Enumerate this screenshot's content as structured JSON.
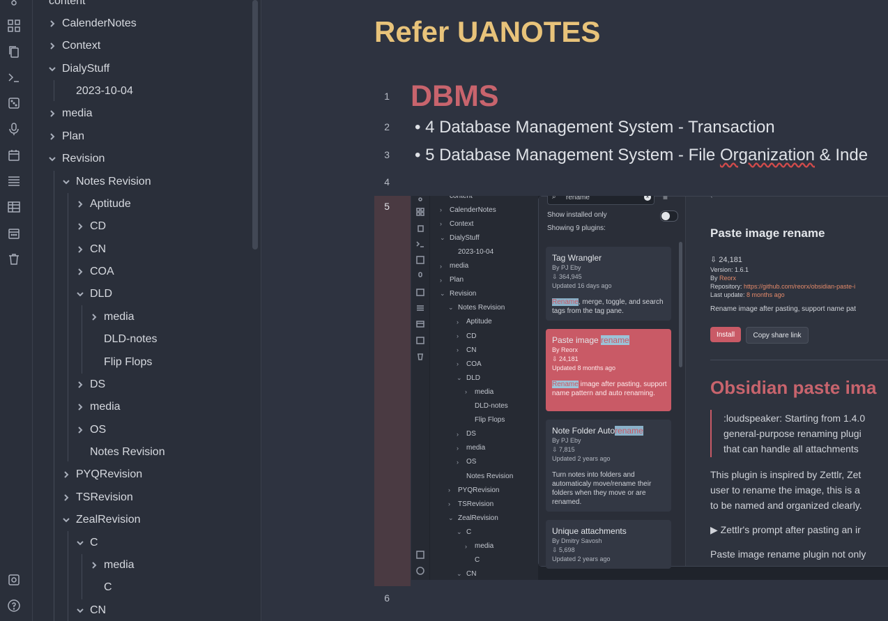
{
  "sidebar": {
    "items": [
      {
        "label": "content",
        "chev": "none",
        "depth": 0
      },
      {
        "label": "CalenderNotes",
        "chev": "right",
        "depth": 0
      },
      {
        "label": "Context",
        "chev": "right",
        "depth": 0
      },
      {
        "label": "DialyStuff",
        "chev": "down",
        "depth": 0
      },
      {
        "label": "2023-10-04",
        "chev": "none",
        "depth": 1
      },
      {
        "label": "media",
        "chev": "right",
        "depth": 0
      },
      {
        "label": "Plan",
        "chev": "right",
        "depth": 0
      },
      {
        "label": "Revision",
        "chev": "down",
        "depth": 0
      },
      {
        "label": "Notes Revision",
        "chev": "down",
        "depth": 1
      },
      {
        "label": "Aptitude",
        "chev": "right",
        "depth": 2
      },
      {
        "label": "CD",
        "chev": "right",
        "depth": 2
      },
      {
        "label": "CN",
        "chev": "right",
        "depth": 2
      },
      {
        "label": "COA",
        "chev": "right",
        "depth": 2
      },
      {
        "label": "DLD",
        "chev": "down",
        "depth": 2
      },
      {
        "label": "media",
        "chev": "right",
        "depth": 3
      },
      {
        "label": "DLD-notes",
        "chev": "none",
        "depth": 3
      },
      {
        "label": "Flip Flops",
        "chev": "none",
        "depth": 3
      },
      {
        "label": "DS",
        "chev": "right",
        "depth": 2
      },
      {
        "label": "media",
        "chev": "right",
        "depth": 2
      },
      {
        "label": "OS",
        "chev": "right",
        "depth": 2
      },
      {
        "label": "Notes Revision",
        "chev": "none",
        "depth": 2
      },
      {
        "label": "PYQRevision",
        "chev": "right",
        "depth": 1
      },
      {
        "label": "TSRevision",
        "chev": "right",
        "depth": 1
      },
      {
        "label": "ZealRevision",
        "chev": "down",
        "depth": 1
      },
      {
        "label": "C",
        "chev": "down",
        "depth": 2
      },
      {
        "label": "media",
        "chev": "right",
        "depth": 3
      },
      {
        "label": "C",
        "chev": "none",
        "depth": 3
      },
      {
        "label": "CN",
        "chev": "down",
        "depth": 2
      }
    ]
  },
  "ribbon": {
    "icons": [
      "git-icon",
      "dashboard-icon",
      "copy-icon",
      "terminal-icon",
      "dice-icon",
      "microphone-icon",
      "calendar-icon",
      "list-icon",
      "table-icon",
      "calendar-grid-icon",
      "trash-icon",
      "vault-icon",
      "help-icon"
    ]
  },
  "editor": {
    "title": "Refer UANOTES",
    "lines": [
      {
        "n": "1",
        "text": "DBMS"
      },
      {
        "n": "2",
        "text": "• 4 Database Management System - Transaction"
      },
      {
        "n": "3",
        "text_a": "• 5 Database Management System - File ",
        "text_b": "Organization",
        "text_c": " & Inde"
      },
      {
        "n": "4",
        "text": ""
      },
      {
        "n": "5",
        "text": ""
      },
      {
        "n": "6",
        "text": ""
      }
    ]
  },
  "embed": {
    "sidebar_items": [
      {
        "label": "content",
        "chev": "",
        "depth": 0
      },
      {
        "label": "CalenderNotes",
        "chev": ">",
        "depth": 0
      },
      {
        "label": "Context",
        "chev": ">",
        "depth": 0
      },
      {
        "label": "DialyStuff",
        "chev": "v",
        "depth": 0
      },
      {
        "label": "2023-10-04",
        "chev": "",
        "depth": 1
      },
      {
        "label": "media",
        "chev": ">",
        "depth": 0
      },
      {
        "label": "Plan",
        "chev": ">",
        "depth": 0
      },
      {
        "label": "Revision",
        "chev": "v",
        "depth": 0
      },
      {
        "label": "Notes Revision",
        "chev": "v",
        "depth": 1
      },
      {
        "label": "Aptitude",
        "chev": ">",
        "depth": 2
      },
      {
        "label": "CD",
        "chev": ">",
        "depth": 2
      },
      {
        "label": "CN",
        "chev": ">",
        "depth": 2
      },
      {
        "label": "COA",
        "chev": ">",
        "depth": 2
      },
      {
        "label": "DLD",
        "chev": "v",
        "depth": 2
      },
      {
        "label": "media",
        "chev": ">",
        "depth": 3
      },
      {
        "label": "DLD-notes",
        "chev": "",
        "depth": 3
      },
      {
        "label": "Flip Flops",
        "chev": "",
        "depth": 3
      },
      {
        "label": "DS",
        "chev": ">",
        "depth": 2
      },
      {
        "label": "media",
        "chev": ">",
        "depth": 2
      },
      {
        "label": "OS",
        "chev": ">",
        "depth": 2
      },
      {
        "label": "Notes Revision",
        "chev": "",
        "depth": 2
      },
      {
        "label": "PYQRevision",
        "chev": ">",
        "depth": 1
      },
      {
        "label": "TSRevision",
        "chev": ">",
        "depth": 1
      },
      {
        "label": "ZealRevision",
        "chev": "v",
        "depth": 1
      },
      {
        "label": "C",
        "chev": "v",
        "depth": 2
      },
      {
        "label": "media",
        "chev": ">",
        "depth": 3
      },
      {
        "label": "C",
        "chev": "",
        "depth": 3
      },
      {
        "label": "CN",
        "chev": "v",
        "depth": 2
      }
    ],
    "search_value": "rename",
    "show_installed_label": "Show installed only",
    "showing_count": "Showing 9 plugins:",
    "plugins": [
      {
        "name": "Tag Wrangler",
        "name_hl": "",
        "author": "By PJ Eby",
        "downloads": "364,945",
        "updated": "Updated 16 days ago",
        "desc_hl": "Rename",
        "desc": ", merge, toggle, and search tags from the tag pane.",
        "selected": false
      },
      {
        "name": "Paste image ",
        "name_hl": "rename",
        "author": "By Reorx",
        "downloads": "24,181",
        "updated": "Updated 8 months ago",
        "desc_hl": "Rename",
        "desc": " image after pasting, support name pattern and auto renaming.",
        "selected": true
      },
      {
        "name": "Note Folder Auto",
        "name_hl": "rename",
        "author": "By PJ Eby",
        "downloads": "7,815",
        "updated": "Updated 2 years ago",
        "desc_hl": "",
        "desc": "Turn notes into folders and automaticaly move/rename their folders when they move or are renamed.",
        "selected": false
      },
      {
        "name": "Unique attachments",
        "name_hl": "",
        "author": "By Dmitry Savosh",
        "downloads": "5,698",
        "updated": "Updated 2 years ago",
        "desc_hl": "",
        "desc": "",
        "selected": false
      }
    ],
    "detail": {
      "title": "Paste image rename",
      "downloads": "24,181",
      "version": "Version: 1.6.1",
      "by_label": "By ",
      "by": "Reorx",
      "repo_label": "Repository: ",
      "repo": "https://github.com/reorx/obsidian-paste-i",
      "last_update_label": "Last update: ",
      "last_update": "8 months ago",
      "summary": "Rename image after pasting, support name pat",
      "install_label": "Install",
      "share_label": "Copy share link",
      "readme_heading": "Obsidian paste ima",
      "quote1": ":loudspeaker: Starting from 1.4.0",
      "quote2": "general-purpose renaming plugi",
      "quote3": "that can handle all attachments",
      "para1": "This plugin is inspired by Zettlr, Zet",
      "para2": "user to rename the image, this is a",
      "para3": "to be named and organized clearly.",
      "details_label": "▶ Zettlr's prompt after pasting an ir",
      "para4": "Paste image rename plugin not only"
    }
  },
  "colors": {
    "title": "#e8c37a",
    "heading": "#c8646d",
    "accent": "#c95a66",
    "link": "#e48a6a"
  }
}
